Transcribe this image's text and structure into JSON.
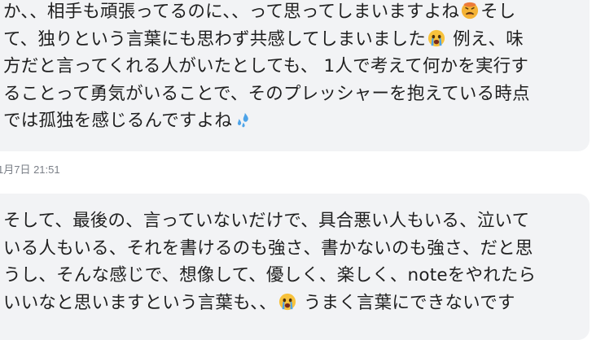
{
  "messages": [
    {
      "lines": [
        {
          "text": "か、、相手も頑張ってるのに、、って思ってしまいますよね",
          "emoji": "tired-face-icon",
          "after": "そし"
        },
        {
          "text": "て、独りという言葉にも思わず共感してしまいました",
          "emoji": "crying-face-icon",
          "after": " 例え、味"
        },
        {
          "text": "方だと言ってくれる人がいたとしても、 1人で考えて何かを実行す"
        },
        {
          "text": "ることって勇気がいることで、そのプレッシャーを抱えている時点"
        },
        {
          "text": "では孤独を感じるんですよね",
          "emoji": "sweat-droplets-icon",
          "after": ""
        }
      ]
    },
    {
      "lines": [
        {
          "text": "そして、最後の、言っていないだけで、具合悪い人もいる、泣いて"
        },
        {
          "text": "いる人もいる、それを書けるのも強さ、書かないのも強さ、だと思"
        },
        {
          "text": "うし、そんな感じで、想像して、優しく、楽しく、noteをやれたら"
        },
        {
          "text": "いいなと思いますという言葉も、、",
          "emoji": "crying-face-icon",
          "after": " うまく言葉にできないです"
        }
      ]
    }
  ],
  "timestamp": "1月7日 21:51",
  "colors": {
    "bubble_bg": "#f2f3f5",
    "text": "#1f1f1f",
    "timestamp": "#7a7f87"
  }
}
